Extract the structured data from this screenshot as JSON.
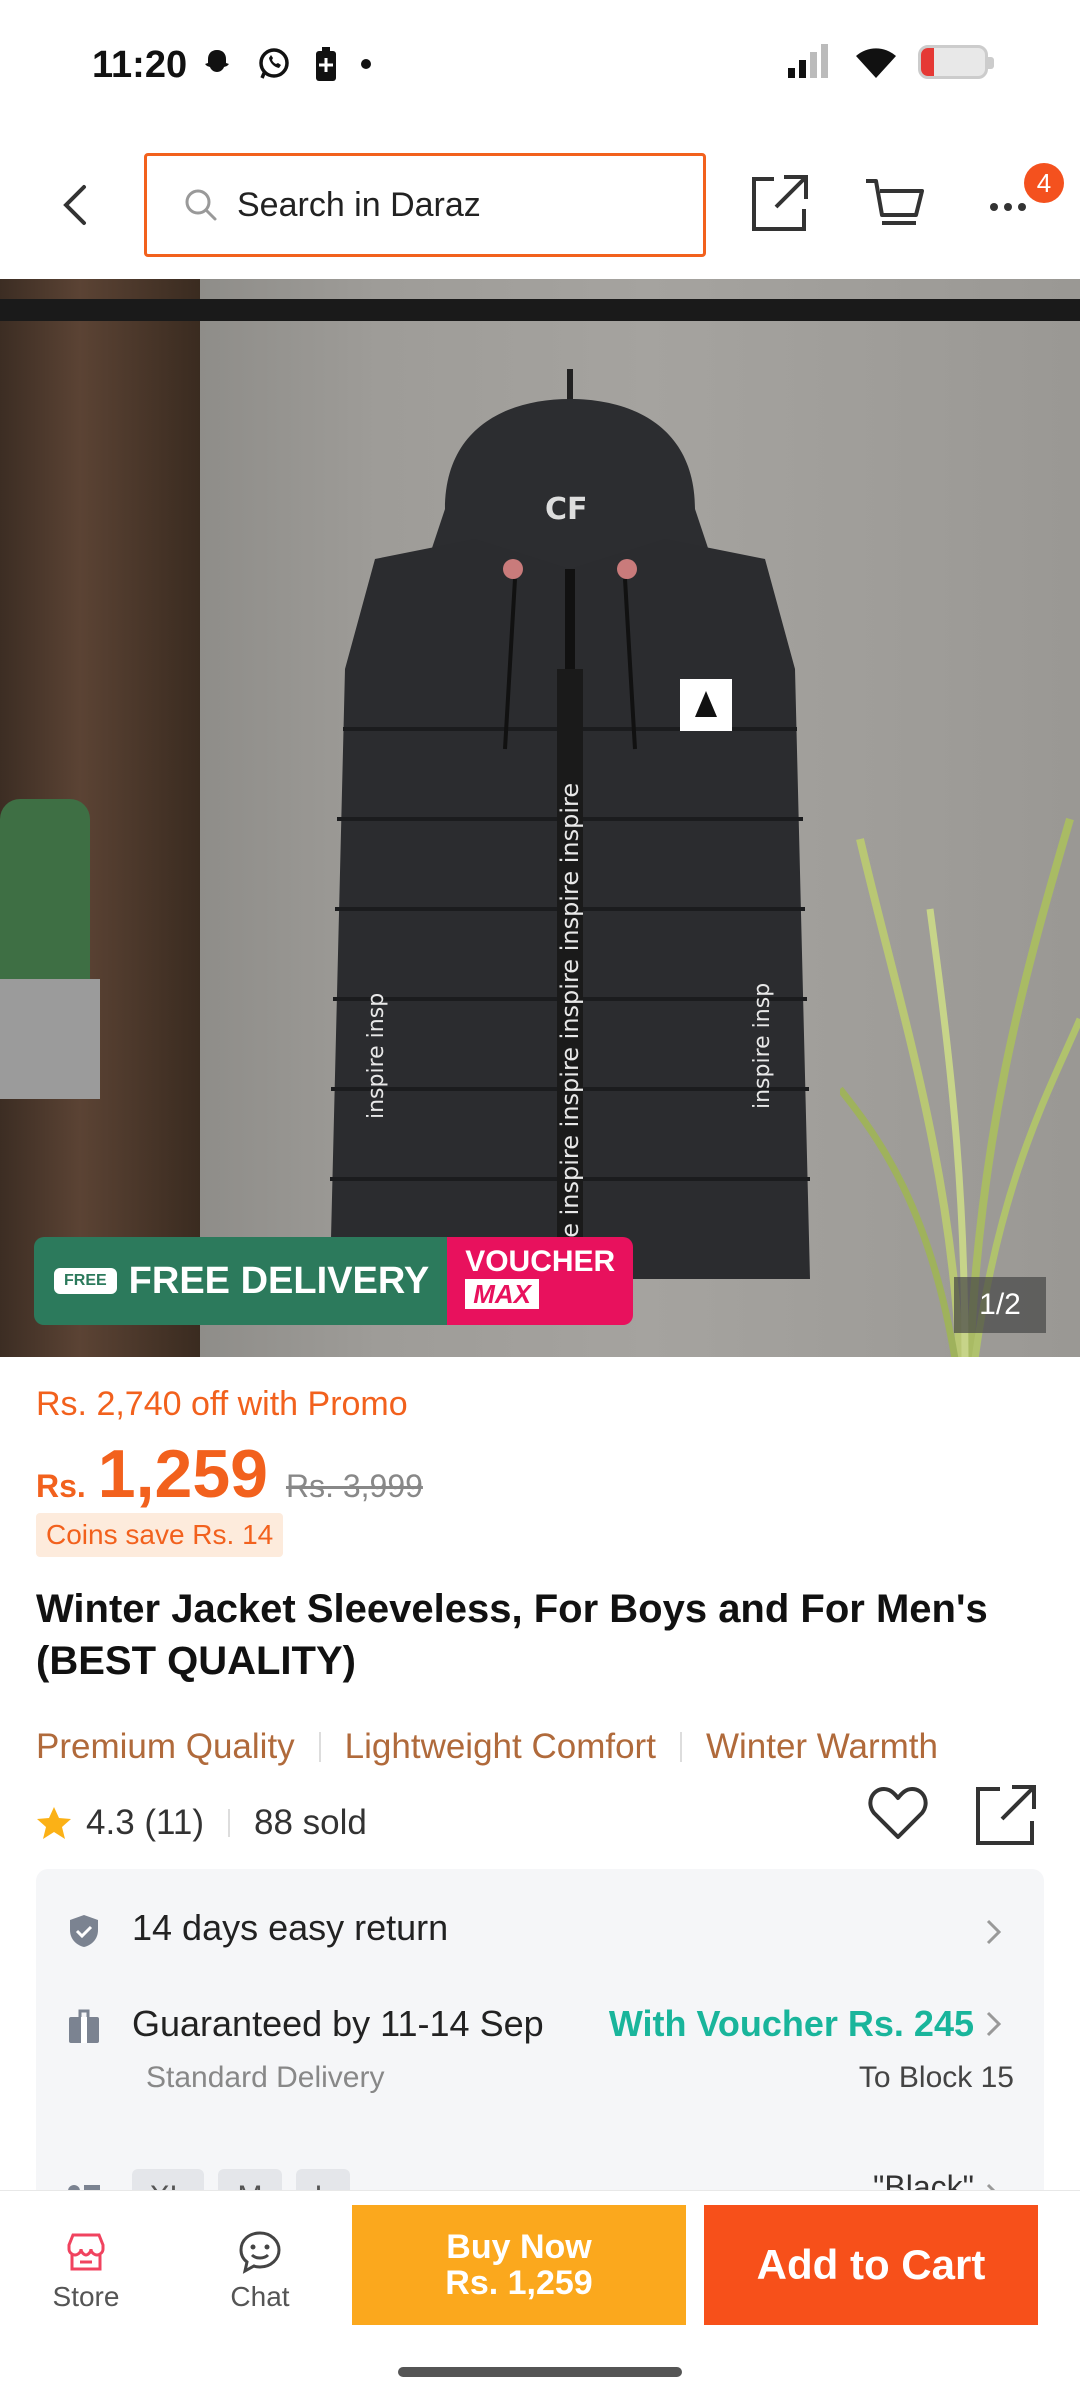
{
  "status_bar": {
    "time": "11:20",
    "notification_icons": [
      "snapchat-icon",
      "whatsapp-icon",
      "battery-saver-icon",
      "dot-icon"
    ],
    "battery_level": 0.2
  },
  "top_bar": {
    "search_placeholder": "Search in Daraz",
    "more_badge": "4"
  },
  "gallery": {
    "banner_free": "FREE DELIVERY",
    "banner_free_small": "FREE",
    "banner_voucher": "VOUCHER",
    "banner_voucher_max": "MAX",
    "counter": "1/2"
  },
  "product": {
    "promo": "Rs. 2,740 off with Promo",
    "currency": "Rs.",
    "price": "1,259",
    "old_price": "Rs. 3,999",
    "coins": "Coins save Rs. 14",
    "title": "Winter Jacket Sleeveless, For Boys and For Men's (BEST QUALITY)",
    "tags": [
      "Premium Quality",
      "Lightweight Comfort",
      "Winter Warmth"
    ],
    "rating": "4.3 (11)",
    "sold": "88 sold"
  },
  "details": {
    "return_label": "14 days easy return",
    "delivery_label": "Guaranteed by 11-14 Sep",
    "voucher_label": "With Voucher Rs. 245",
    "delivery_type": "Standard Delivery",
    "location": "To Block 15",
    "sizes": [
      "XL",
      "M",
      "L"
    ],
    "selected_variant": "\"Black\""
  },
  "bottom_bar": {
    "store_label": "Store",
    "chat_label": "Chat",
    "buy_now_label": "Buy Now",
    "buy_now_price": "Rs. 1,259",
    "add_to_cart_label": "Add to Cart"
  },
  "colors": {
    "brand_orange": "#f2611d",
    "buy_now": "#fba81d",
    "add_to_cart": "#f7501a",
    "voucher_green": "#19b59b",
    "tag_brown": "#b06a3b"
  }
}
